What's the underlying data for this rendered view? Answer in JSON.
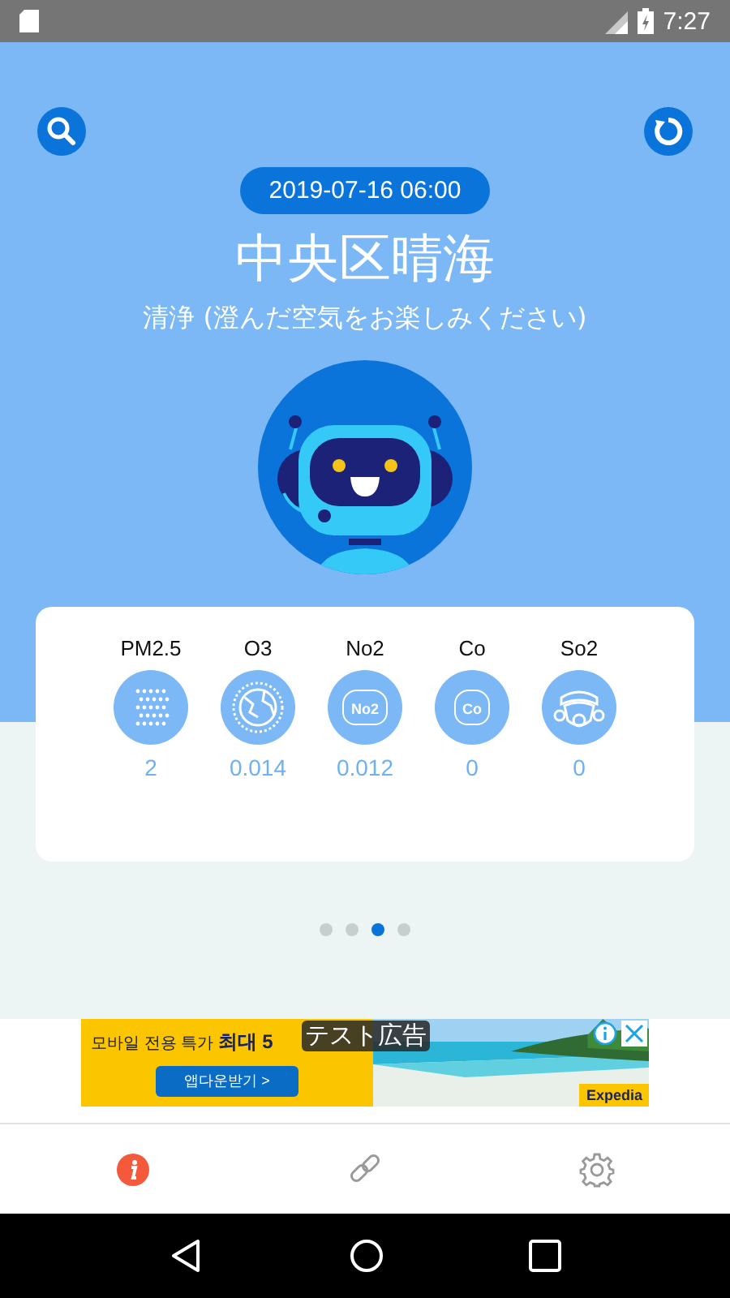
{
  "status_bar": {
    "time": "7:27"
  },
  "header": {
    "datetime": "2019-07-16 06:00",
    "location": "中央区晴海",
    "quality": "清浄 (澄んだ空気をお楽しみください)"
  },
  "pollutants": [
    {
      "kind": "pm",
      "label": "PM2.5",
      "value": "2"
    },
    {
      "kind": "globe",
      "label": "O3",
      "value": "0.014"
    },
    {
      "kind": "cloud",
      "label": "No2",
      "value": "0.012",
      "badge": "No2"
    },
    {
      "kind": "cloud",
      "label": "Co",
      "value": "0",
      "badge": "Co"
    },
    {
      "kind": "mask",
      "label": "So2",
      "value": "0"
    }
  ],
  "pages": [
    {
      "selected": false
    },
    {
      "selected": false
    },
    {
      "selected": true
    },
    {
      "selected": false
    }
  ],
  "ad": {
    "label": "テスト広告",
    "headline": "모바일 전용 특가",
    "headline_bold": "최대 5",
    "button": "앱다운받기 >",
    "brand": "Expedia"
  },
  "tabs": [
    {
      "kind": "info",
      "selected": true
    },
    {
      "kind": "link",
      "selected": false
    },
    {
      "kind": "settings",
      "selected": false
    }
  ]
}
